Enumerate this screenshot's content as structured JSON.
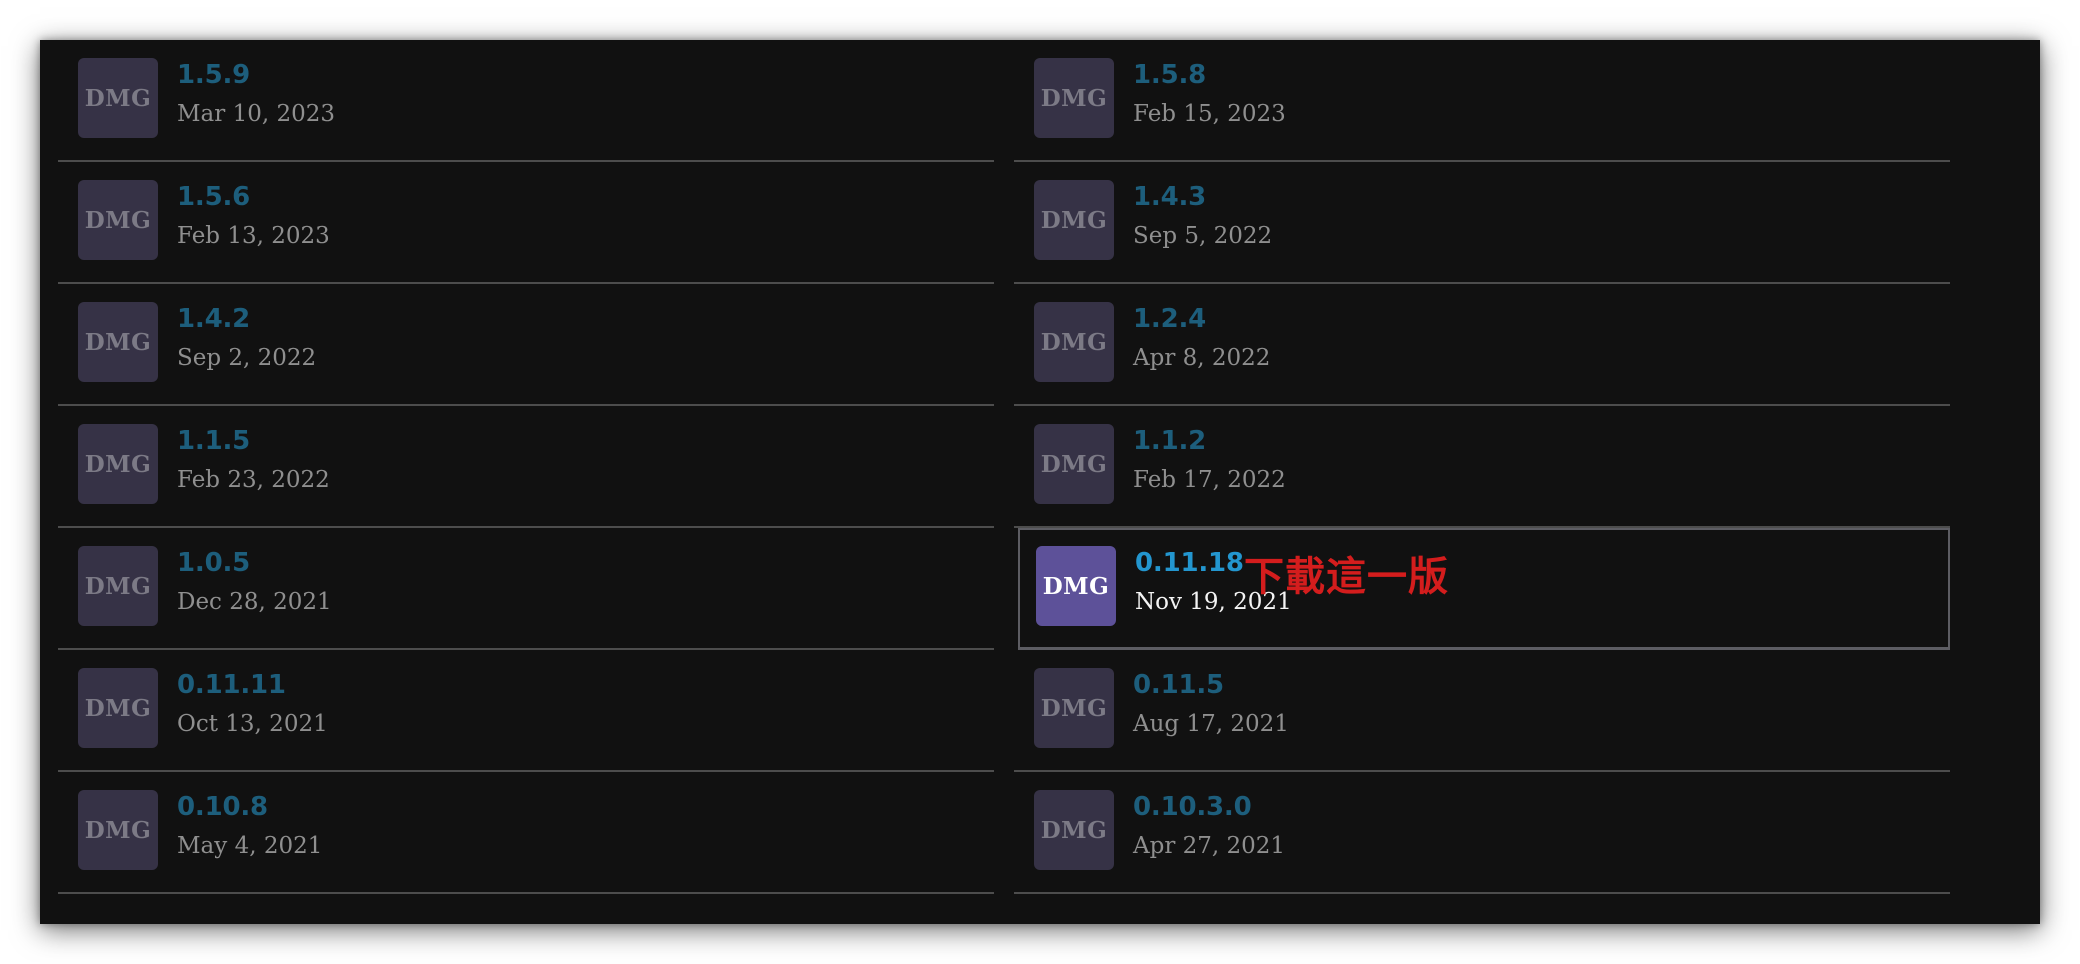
{
  "badge_label": "DMG",
  "colors": {
    "background": "#111111",
    "badge": "#363246",
    "badge_highlight": "#5d5199",
    "version": "#1d5e7c",
    "version_highlight": "#2396cf",
    "date": "#8f8f8f",
    "annotation": "#d41d1d"
  },
  "releases": [
    {
      "version": "1.5.9",
      "date": "Mar 10, 2023"
    },
    {
      "version": "1.5.8",
      "date": "Feb 15, 2023"
    },
    {
      "version": "1.5.6",
      "date": "Feb 13, 2023"
    },
    {
      "version": "1.4.3",
      "date": "Sep 5, 2022"
    },
    {
      "version": "1.4.2",
      "date": "Sep 2, 2022"
    },
    {
      "version": "1.2.4",
      "date": "Apr 8, 2022"
    },
    {
      "version": "1.1.5",
      "date": "Feb 23, 2022"
    },
    {
      "version": "1.1.2",
      "date": "Feb 17, 2022"
    },
    {
      "version": "1.0.5",
      "date": "Dec 28, 2021"
    },
    {
      "version": "0.11.18",
      "date": "Nov 19, 2021",
      "highlighted": true
    },
    {
      "version": "0.11.11",
      "date": "Oct 13, 2021"
    },
    {
      "version": "0.11.5",
      "date": "Aug 17, 2021"
    },
    {
      "version": "0.10.8",
      "date": "May 4, 2021"
    },
    {
      "version": "0.10.3.0",
      "date": "Apr 27, 2021"
    }
  ],
  "annotation": "下載這一版"
}
